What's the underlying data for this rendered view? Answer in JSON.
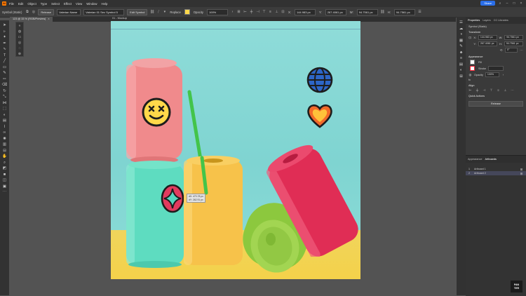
{
  "app": {
    "logo": "Ai"
  },
  "menu": {
    "items": [
      "File",
      "Edit",
      "Object",
      "Type",
      "Select",
      "Effect",
      "View",
      "Window",
      "Help"
    ]
  },
  "share": {
    "label": "Share"
  },
  "control_bar": {
    "selection_type": "Symbol (Static)",
    "release_label": "Release",
    "symbol_name": "Valerian Name",
    "symbol_lib": "Valerian 01 Sec Symbol 5",
    "edit_symbol_label": "Edit Symbol",
    "replace_label": "Replace",
    "opacity_label": "Opacity",
    "opacity_value": "100%",
    "x_label": "X:",
    "x_value": "144.983 px",
    "y_label": "Y:",
    "y_value": "267.4061 px",
    "w_label": "W:",
    "w_value": "94.7561 px",
    "h_label": "H:",
    "h_value": "94.7561 px"
  },
  "document_tab": {
    "label": "123 @ 33 % (RGB/Preview)",
    "close": "×"
  },
  "artboard": {
    "label": "01 - Mockup"
  },
  "measure_tooltip": {
    "line1": "dX: 470.78 px",
    "line2": "dY: 262.91 px"
  },
  "properties_panel": {
    "tabs": [
      "Properties",
      "Layers",
      "CC Libraries"
    ],
    "selection": "Symbol (Static)",
    "transform_title": "Transform",
    "x_label": "X:",
    "x_value": "144.983 px",
    "y_label": "Y:",
    "y_value": "267.4061 px",
    "w_label": "W:",
    "w_value": "94.7561 px",
    "h_label": "H:",
    "h_value": "94.7561 px",
    "angle_value": "0°",
    "appearance_title": "Appearance",
    "fill_label": "Fill",
    "stroke_label": "Stroke",
    "opacity_label": "Opacity",
    "opacity_value": "100%",
    "fx_label": "fx",
    "align_title": "Align",
    "quick_actions_title": "Quick Actions",
    "release_label": "Release"
  },
  "artboards_panel": {
    "tabs": [
      "Appearance",
      "Artboards"
    ],
    "rows": [
      {
        "num": "1",
        "name": "Artboard 1"
      },
      {
        "num": "2",
        "name": "Artboard 2"
      }
    ]
  },
  "brand": {
    "line1": "PAN",
    "line2": "TER"
  },
  "colors": {
    "can_pink": "#f08a8c",
    "can_mint": "#5edcc0",
    "can_yellow": "#f7c24a",
    "can_green": "#8cc83e",
    "can_red": "#e02d55",
    "sticker_yellow": "#ffd84a",
    "sticker_heart": "#f26a2a",
    "sticker_globe": "#2d66c8",
    "accent_blue": "#2a6ee8"
  }
}
